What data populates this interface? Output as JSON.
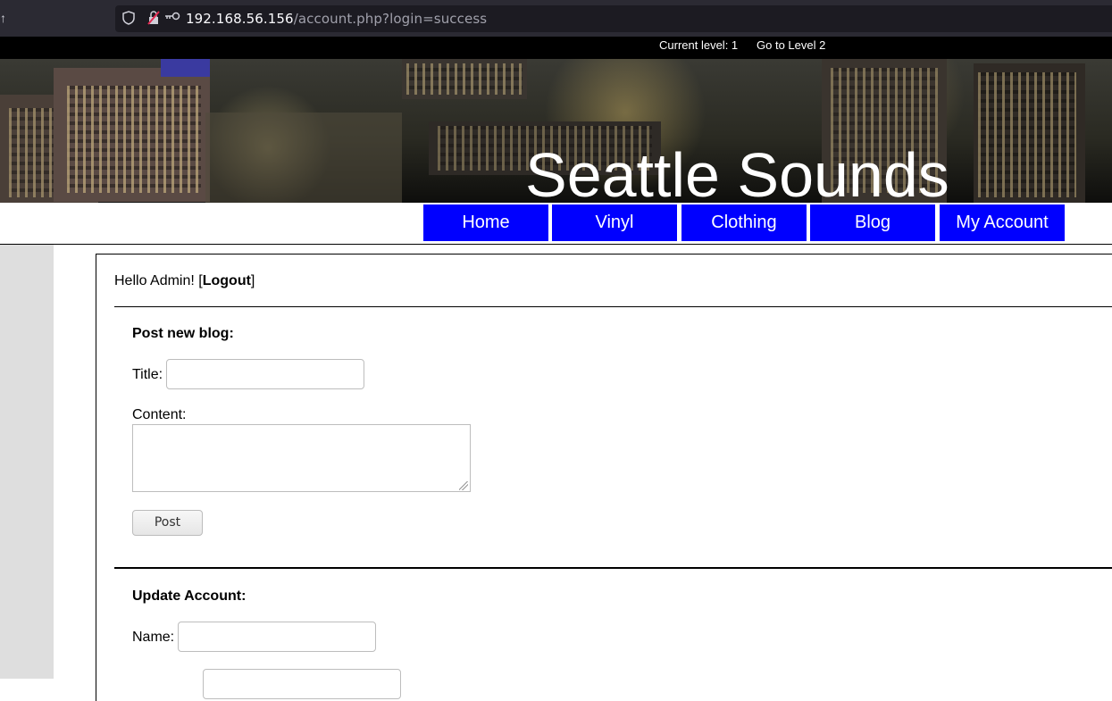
{
  "browser": {
    "back_glyph": "↑",
    "url_host": "192.168.56.156",
    "url_path": "/account.php?login=success"
  },
  "level_bar": {
    "current_level": "Current level: 1",
    "goto_link": "Go to Level 2"
  },
  "site": {
    "title": "Seattle Sounds"
  },
  "nav": {
    "items": [
      {
        "label": "Home"
      },
      {
        "label": "Vinyl"
      },
      {
        "label": "Clothing"
      },
      {
        "label": "Blog"
      },
      {
        "label": "My Account"
      }
    ],
    "button_color": "#0000ff"
  },
  "account": {
    "greeting": "Hello Admin! [",
    "logout_label": "Logout",
    "greeting_end": "]"
  },
  "blog_form": {
    "heading": "Post new blog:",
    "title_label": "Title:",
    "title_value": "",
    "content_label": "Content:",
    "content_value": "",
    "submit_label": "Post"
  },
  "update_form": {
    "heading": "Update Account:",
    "name_label": "Name:",
    "name_value": ""
  }
}
